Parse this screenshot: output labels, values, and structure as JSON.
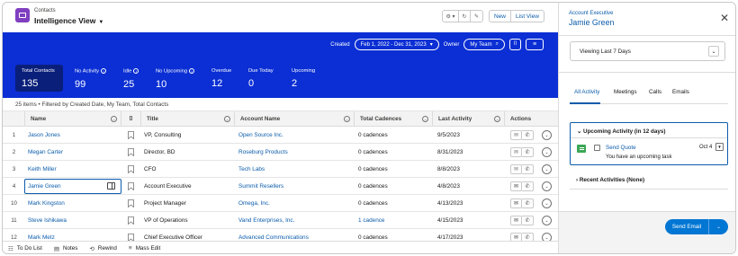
{
  "header": {
    "object_label": "Contacts",
    "view_title": "Intelligence View",
    "toolbar": {
      "settings_icon": "⚙ ▾",
      "refresh_icon": "↻",
      "edit_icon": "✎",
      "new_label": "New",
      "list_view_label": "List View"
    }
  },
  "filters": {
    "created_label": "Created",
    "date_range": "Feb 1, 2022 - Dec 31, 2023",
    "owner_label": "Owner",
    "owner_value": "My Team"
  },
  "metrics": [
    {
      "label": "Total Contacts",
      "value": "135",
      "info": false
    },
    {
      "label": "No Activity",
      "value": "99",
      "info": true
    },
    {
      "label": "Idle",
      "value": "25",
      "info": true
    },
    {
      "label": "No Upcoming",
      "value": "10",
      "info": true
    },
    {
      "label": "Overdue",
      "value": "12",
      "info": false
    },
    {
      "label": "Due Today",
      "value": "0",
      "info": false
    },
    {
      "label": "Upcoming",
      "value": "2",
      "info": false
    }
  ],
  "info_bar": "25 items • Filtered by Created Date, My Team, Total Contacts",
  "table": {
    "columns": {
      "name": "Name",
      "title": "Title",
      "account": "Account Name",
      "cadences": "Total Cadences",
      "last_activity": "Last Activity",
      "actions": "Actions"
    },
    "rows": [
      {
        "num": "1",
        "name": "Jason Jones",
        "title": "VP, Consulting",
        "account": "Open Source Inc.",
        "cadences": "0 cadences",
        "last": "9/5/2023"
      },
      {
        "num": "2",
        "name": "Megan Carter",
        "title": "Director, BD",
        "account": "Roseburg Products",
        "cadences": "0 cadences",
        "last": "8/31/2023"
      },
      {
        "num": "3",
        "name": "Keith Miller",
        "title": "CFO",
        "account": "Tech Labs",
        "cadences": "0 cadences",
        "last": "8/8/2023"
      },
      {
        "num": "4",
        "name": "Jamie Green",
        "title": "Account Executive",
        "account": "Summit Resellers",
        "cadences": "0 cadences",
        "last": "4/8/2023"
      },
      {
        "num": "10",
        "name": "Mark Kingston",
        "title": "Project Manager",
        "account": "Omega, Inc.",
        "cadences": "0 cadences",
        "last": "4/13/2023"
      },
      {
        "num": "11",
        "name": "Steve Ishikawa",
        "title": "VP of Operations",
        "account": "Vand Enterprises, Inc.",
        "cadences": "1 cadence",
        "last": "4/15/2023"
      },
      {
        "num": "12",
        "name": "Mark Metz",
        "title": "Chief Executive Officer",
        "account": "Advanced Communications",
        "cadences": "0 cadences",
        "last": "4/17/2023"
      }
    ]
  },
  "footer": [
    {
      "label": "To Do List",
      "icon": "☷"
    },
    {
      "label": "Notes",
      "icon": "▤"
    },
    {
      "label": "Rewind",
      "icon": "⟲"
    },
    {
      "label": "Mass Edit",
      "icon": "≡"
    }
  ],
  "panel": {
    "role": "Account Executive",
    "name": "Jamie Green",
    "period": "Viewing Last 7 Days",
    "tabs": [
      "All Activity",
      "Meetings",
      "Calls",
      "Emails"
    ],
    "upcoming_header": "Upcoming Activity (in 12 days)",
    "task_title": "Send Quote",
    "task_date": "Oct 4",
    "task_note": "You have an upcoming task",
    "recent_header": "Recent Activities (None)",
    "send_email_label": "Send Email"
  },
  "colors": {
    "banner": "#0b2fd4",
    "highlight_tile": "#0a1f7a",
    "link": "#0b5cab",
    "primary_button": "#0176d3",
    "app_icon": "#7f3fbf",
    "task_icon": "#3ba755"
  }
}
